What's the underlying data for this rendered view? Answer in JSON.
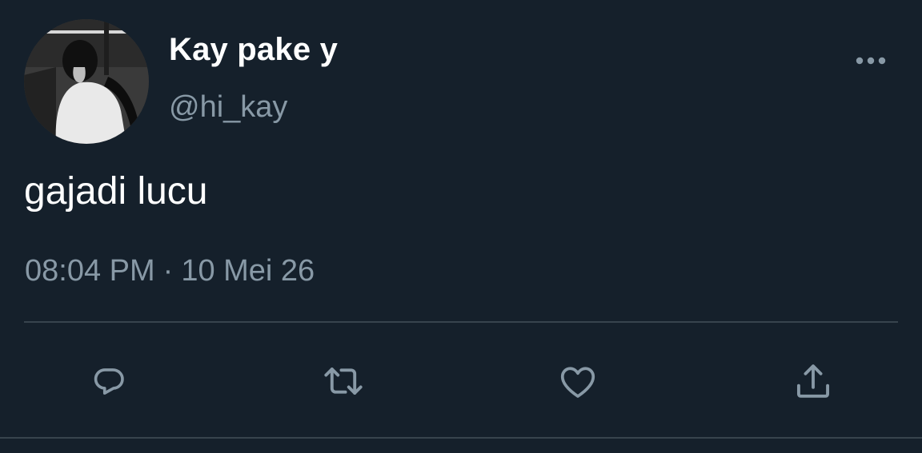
{
  "tweet": {
    "display_name": "Kay pake y",
    "handle": "@hi_kay",
    "text": "gajadi lucu",
    "time": "08:04 PM",
    "separator": "·",
    "date": "10 Mei 26"
  },
  "icons": {
    "more": "more-horizontal-icon",
    "reply": "reply-icon",
    "retweet": "retweet-icon",
    "like": "heart-icon",
    "share": "share-icon"
  },
  "colors": {
    "background": "#15202b",
    "primary_text": "#ffffff",
    "secondary_text": "#8899a6",
    "divider": "#38444d"
  }
}
